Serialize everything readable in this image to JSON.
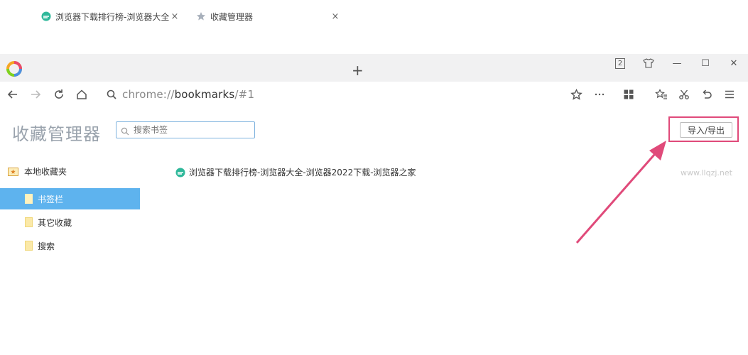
{
  "browser": {
    "tabs": [
      {
        "title": "浏览器下载排行榜-浏览器大全",
        "close": "×"
      },
      {
        "title": "收藏管理器",
        "close": "×"
      }
    ],
    "new_tab": "+",
    "tab_count_badge": "2",
    "window_controls": {
      "minimize": "—",
      "maximize": "☐",
      "close": "✕"
    },
    "address": {
      "scheme": "chrome://",
      "host": "bookmarks",
      "path": "/#1"
    }
  },
  "page": {
    "title": "收藏管理器",
    "search": {
      "placeholder": "搜索书签"
    },
    "import_export_label": "导入/导出"
  },
  "sidebar": {
    "root_label": "本地收藏夹",
    "items": [
      {
        "label": "书签栏",
        "selected": true
      },
      {
        "label": "其它收藏",
        "selected": false
      },
      {
        "label": "搜索",
        "selected": false
      }
    ]
  },
  "bookmarks": [
    {
      "title": "浏览器下载排行榜-浏览器大全-浏览器2022下载-浏览器之家"
    }
  ],
  "watermark": "www.llqzj.net",
  "colors": {
    "accent_selected": "#5eb3ee",
    "highlight_box": "#e04a7a",
    "arrow": "#e04a7a"
  },
  "icons": [
    "browser-logo-icon",
    "leaf-favicon-icon",
    "star-favicon-icon",
    "back-icon",
    "forward-icon",
    "reload-icon",
    "home-icon",
    "search-icon",
    "star-icon",
    "more-icon",
    "apps-icon",
    "favorites-icon",
    "scissors-icon",
    "undo-icon",
    "menu-icon",
    "skin-icon",
    "folder-icon",
    "star-folder-icon"
  ]
}
